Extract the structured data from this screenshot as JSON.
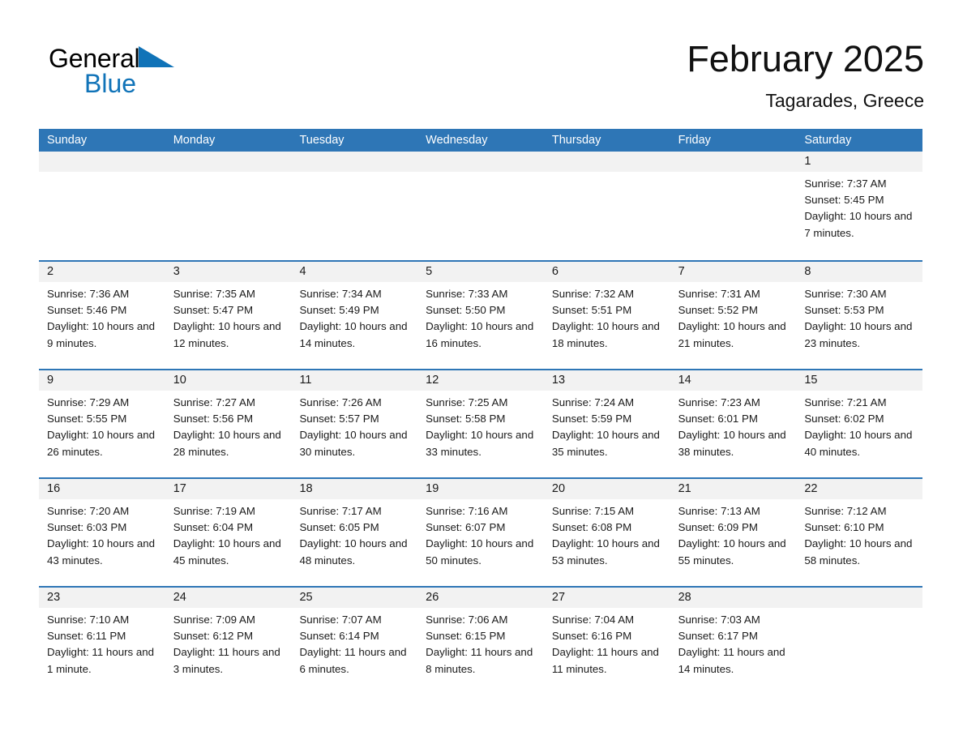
{
  "brand": {
    "name_part1": "General",
    "name_part2": "Blue",
    "accent_color": "#1073b8"
  },
  "header": {
    "title": "February 2025",
    "subtitle": "Tagarades, Greece"
  },
  "theme": {
    "header_blue": "#2e76b6",
    "day_band_gray": "#f2f2f2",
    "text_color": "#1a1a1a"
  },
  "weekdays": [
    "Sunday",
    "Monday",
    "Tuesday",
    "Wednesday",
    "Thursday",
    "Friday",
    "Saturday"
  ],
  "weeks": [
    [
      {
        "day": "",
        "sunrise": "",
        "sunset": "",
        "daylight": "",
        "empty": true
      },
      {
        "day": "",
        "sunrise": "",
        "sunset": "",
        "daylight": "",
        "empty": true
      },
      {
        "day": "",
        "sunrise": "",
        "sunset": "",
        "daylight": "",
        "empty": true
      },
      {
        "day": "",
        "sunrise": "",
        "sunset": "",
        "daylight": "",
        "empty": true
      },
      {
        "day": "",
        "sunrise": "",
        "sunset": "",
        "daylight": "",
        "empty": true
      },
      {
        "day": "",
        "sunrise": "",
        "sunset": "",
        "daylight": "",
        "empty": true
      },
      {
        "day": "1",
        "sunrise": "Sunrise: 7:37 AM",
        "sunset": "Sunset: 5:45 PM",
        "daylight": "Daylight: 10 hours and 7 minutes.",
        "empty": false
      }
    ],
    [
      {
        "day": "2",
        "sunrise": "Sunrise: 7:36 AM",
        "sunset": "Sunset: 5:46 PM",
        "daylight": "Daylight: 10 hours and 9 minutes.",
        "empty": false
      },
      {
        "day": "3",
        "sunrise": "Sunrise: 7:35 AM",
        "sunset": "Sunset: 5:47 PM",
        "daylight": "Daylight: 10 hours and 12 minutes.",
        "empty": false
      },
      {
        "day": "4",
        "sunrise": "Sunrise: 7:34 AM",
        "sunset": "Sunset: 5:49 PM",
        "daylight": "Daylight: 10 hours and 14 minutes.",
        "empty": false
      },
      {
        "day": "5",
        "sunrise": "Sunrise: 7:33 AM",
        "sunset": "Sunset: 5:50 PM",
        "daylight": "Daylight: 10 hours and 16 minutes.",
        "empty": false
      },
      {
        "day": "6",
        "sunrise": "Sunrise: 7:32 AM",
        "sunset": "Sunset: 5:51 PM",
        "daylight": "Daylight: 10 hours and 18 minutes.",
        "empty": false
      },
      {
        "day": "7",
        "sunrise": "Sunrise: 7:31 AM",
        "sunset": "Sunset: 5:52 PM",
        "daylight": "Daylight: 10 hours and 21 minutes.",
        "empty": false
      },
      {
        "day": "8",
        "sunrise": "Sunrise: 7:30 AM",
        "sunset": "Sunset: 5:53 PM",
        "daylight": "Daylight: 10 hours and 23 minutes.",
        "empty": false
      }
    ],
    [
      {
        "day": "9",
        "sunrise": "Sunrise: 7:29 AM",
        "sunset": "Sunset: 5:55 PM",
        "daylight": "Daylight: 10 hours and 26 minutes.",
        "empty": false
      },
      {
        "day": "10",
        "sunrise": "Sunrise: 7:27 AM",
        "sunset": "Sunset: 5:56 PM",
        "daylight": "Daylight: 10 hours and 28 minutes.",
        "empty": false
      },
      {
        "day": "11",
        "sunrise": "Sunrise: 7:26 AM",
        "sunset": "Sunset: 5:57 PM",
        "daylight": "Daylight: 10 hours and 30 minutes.",
        "empty": false
      },
      {
        "day": "12",
        "sunrise": "Sunrise: 7:25 AM",
        "sunset": "Sunset: 5:58 PM",
        "daylight": "Daylight: 10 hours and 33 minutes.",
        "empty": false
      },
      {
        "day": "13",
        "sunrise": "Sunrise: 7:24 AM",
        "sunset": "Sunset: 5:59 PM",
        "daylight": "Daylight: 10 hours and 35 minutes.",
        "empty": false
      },
      {
        "day": "14",
        "sunrise": "Sunrise: 7:23 AM",
        "sunset": "Sunset: 6:01 PM",
        "daylight": "Daylight: 10 hours and 38 minutes.",
        "empty": false
      },
      {
        "day": "15",
        "sunrise": "Sunrise: 7:21 AM",
        "sunset": "Sunset: 6:02 PM",
        "daylight": "Daylight: 10 hours and 40 minutes.",
        "empty": false
      }
    ],
    [
      {
        "day": "16",
        "sunrise": "Sunrise: 7:20 AM",
        "sunset": "Sunset: 6:03 PM",
        "daylight": "Daylight: 10 hours and 43 minutes.",
        "empty": false
      },
      {
        "day": "17",
        "sunrise": "Sunrise: 7:19 AM",
        "sunset": "Sunset: 6:04 PM",
        "daylight": "Daylight: 10 hours and 45 minutes.",
        "empty": false
      },
      {
        "day": "18",
        "sunrise": "Sunrise: 7:17 AM",
        "sunset": "Sunset: 6:05 PM",
        "daylight": "Daylight: 10 hours and 48 minutes.",
        "empty": false
      },
      {
        "day": "19",
        "sunrise": "Sunrise: 7:16 AM",
        "sunset": "Sunset: 6:07 PM",
        "daylight": "Daylight: 10 hours and 50 minutes.",
        "empty": false
      },
      {
        "day": "20",
        "sunrise": "Sunrise: 7:15 AM",
        "sunset": "Sunset: 6:08 PM",
        "daylight": "Daylight: 10 hours and 53 minutes.",
        "empty": false
      },
      {
        "day": "21",
        "sunrise": "Sunrise: 7:13 AM",
        "sunset": "Sunset: 6:09 PM",
        "daylight": "Daylight: 10 hours and 55 minutes.",
        "empty": false
      },
      {
        "day": "22",
        "sunrise": "Sunrise: 7:12 AM",
        "sunset": "Sunset: 6:10 PM",
        "daylight": "Daylight: 10 hours and 58 minutes.",
        "empty": false
      }
    ],
    [
      {
        "day": "23",
        "sunrise": "Sunrise: 7:10 AM",
        "sunset": "Sunset: 6:11 PM",
        "daylight": "Daylight: 11 hours and 1 minute.",
        "empty": false
      },
      {
        "day": "24",
        "sunrise": "Sunrise: 7:09 AM",
        "sunset": "Sunset: 6:12 PM",
        "daylight": "Daylight: 11 hours and 3 minutes.",
        "empty": false
      },
      {
        "day": "25",
        "sunrise": "Sunrise: 7:07 AM",
        "sunset": "Sunset: 6:14 PM",
        "daylight": "Daylight: 11 hours and 6 minutes.",
        "empty": false
      },
      {
        "day": "26",
        "sunrise": "Sunrise: 7:06 AM",
        "sunset": "Sunset: 6:15 PM",
        "daylight": "Daylight: 11 hours and 8 minutes.",
        "empty": false
      },
      {
        "day": "27",
        "sunrise": "Sunrise: 7:04 AM",
        "sunset": "Sunset: 6:16 PM",
        "daylight": "Daylight: 11 hours and 11 minutes.",
        "empty": false
      },
      {
        "day": "28",
        "sunrise": "Sunrise: 7:03 AM",
        "sunset": "Sunset: 6:17 PM",
        "daylight": "Daylight: 11 hours and 14 minutes.",
        "empty": false
      },
      {
        "day": "",
        "sunrise": "",
        "sunset": "",
        "daylight": "",
        "empty": true
      }
    ]
  ]
}
